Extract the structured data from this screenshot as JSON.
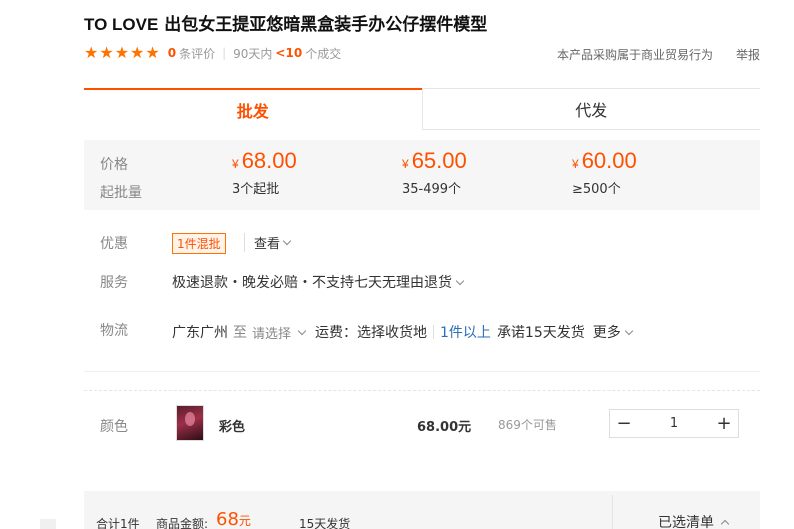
{
  "product": {
    "title_latin": "TO LOVE",
    "title_cn": " 出包女王提亚悠暗黑盒装手办公仔摆件模型"
  },
  "rating": {
    "review_count": "0",
    "review_suffix": "条评价",
    "period": "90天内",
    "deal_count": "<10",
    "deal_suffix": "个成交",
    "biz_note": "本产品采购属于商业贸易行为",
    "report": "举报"
  },
  "tabs": [
    {
      "label": "批发",
      "active": true
    },
    {
      "label": "代发",
      "active": false
    }
  ],
  "pricing": {
    "price_label": "价格",
    "moq_label": "起批量",
    "currency": "¥",
    "tiers": [
      {
        "price": "68.00",
        "qty": "3个起批"
      },
      {
        "price": "65.00",
        "qty": "35-499个"
      },
      {
        "price": "60.00",
        "qty": "≥500个"
      }
    ]
  },
  "promo": {
    "label": "优惠",
    "tag": "1件混批",
    "view": "查看"
  },
  "service": {
    "label": "服务",
    "text": "极速退款・晚发必赔・不支持七天无理由退货"
  },
  "logistics": {
    "label": "物流",
    "from": "广东广州",
    "to_word": "至",
    "select": "请选择",
    "freight": "运费：选择收货地",
    "min_qty": "1件以上",
    "promise": "承诺15天发货",
    "more": "更多"
  },
  "variant": {
    "label": "颜色",
    "name": "彩色",
    "price": "68.00元",
    "stock": "869个可售",
    "quantity": "1",
    "minus": "−",
    "plus": "+"
  },
  "footer": {
    "total_count": "合计1件",
    "amount_label": "商品金额:",
    "amount": "68",
    "amount_unit": "元",
    "ship_time": "15天发货",
    "selected_list": "已选清单"
  },
  "colors": {
    "accent": "#ff5000",
    "link": "#2a6eb8"
  }
}
